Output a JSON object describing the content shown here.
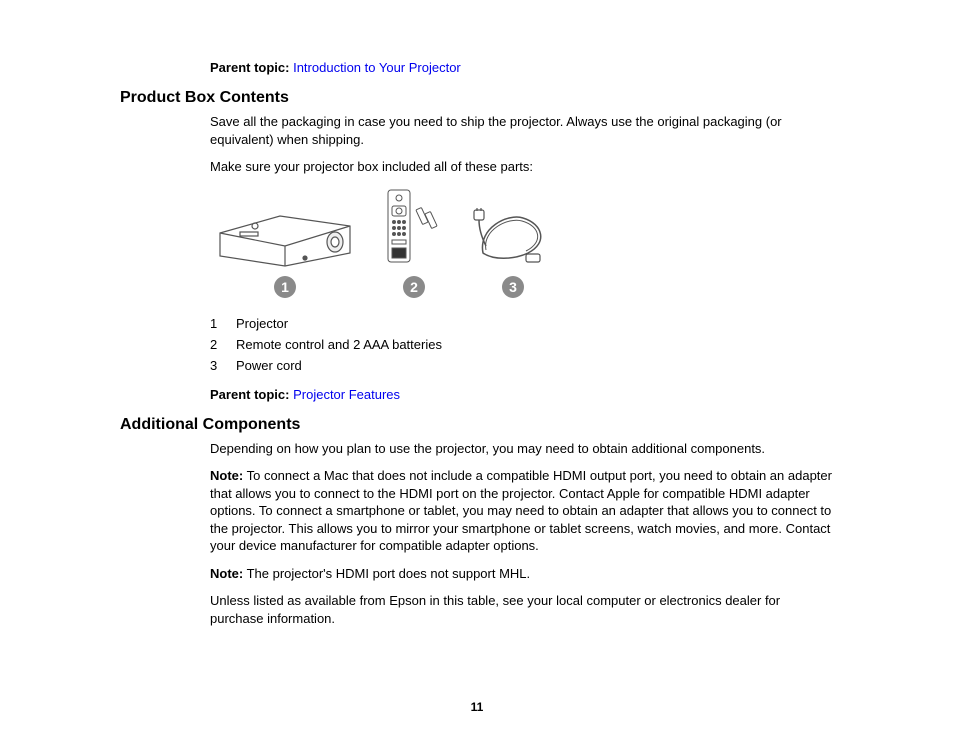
{
  "parentTopic1": {
    "label": "Parent topic:",
    "link": "Introduction to Your Projector"
  },
  "section1": {
    "heading": "Product Box Contents",
    "para1": "Save all the packaging in case you need to ship the projector. Always use the original packaging (or equivalent) when shipping.",
    "para2": "Make sure your projector box included all of these parts:",
    "numbers": {
      "n1": "1",
      "n2": "2",
      "n3": "3"
    },
    "partsList": [
      {
        "num": "1",
        "text": "Projector"
      },
      {
        "num": "2",
        "text": "Remote control and 2 AAA batteries"
      },
      {
        "num": "3",
        "text": "Power cord"
      }
    ]
  },
  "parentTopic2": {
    "label": "Parent topic:",
    "link": "Projector Features"
  },
  "section2": {
    "heading": "Additional Components",
    "para1": "Depending on how you plan to use the projector, you may need to obtain additional components.",
    "note1Label": "Note:",
    "note1": " To connect a Mac that does not include a compatible HDMI output port, you need to obtain an adapter that allows you to connect to the HDMI port on the projector. Contact Apple for compatible HDMI adapter options. To connect a smartphone or tablet, you may need to obtain an adapter that allows you to connect to the projector. This allows you to mirror your smartphone or tablet screens, watch movies, and more. Contact your device manufacturer for compatible adapter options.",
    "note2Label": "Note:",
    "note2": " The projector's HDMI port does not support MHL.",
    "para2": "Unless listed as available from Epson in this table, see your local computer or electronics dealer for purchase information."
  },
  "pageNumber": "11"
}
